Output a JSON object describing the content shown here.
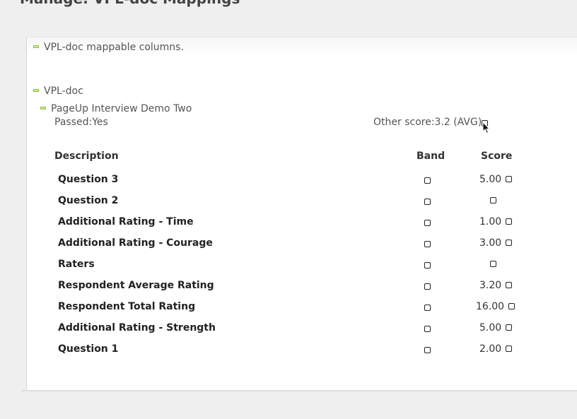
{
  "page": {
    "title": "Manage: VPL-doc Mappings"
  },
  "section": {
    "title": "VPL-doc mappable columns.",
    "group": "VPL-doc",
    "interview": "PageUp Interview Demo Two"
  },
  "summary": {
    "passed_label": "Passed:",
    "passed_value": "Yes",
    "other_score_label": "Other score:",
    "other_score_value": "3.2 (AVG)"
  },
  "table": {
    "columns": [
      "Description",
      "Band",
      "Score"
    ],
    "rows": [
      {
        "label": "Question 3",
        "score": "5.00"
      },
      {
        "label": "Question 2",
        "score": ""
      },
      {
        "label": "Additional Rating - Time",
        "score": "1.00"
      },
      {
        "label": "Additional Rating - Courage",
        "score": "3.00"
      },
      {
        "label": "Raters",
        "score": ""
      },
      {
        "label": "Respondent Average Rating",
        "score": "3.20"
      },
      {
        "label": "Respondent Total Rating",
        "score": "16.00"
      },
      {
        "label": "Additional Rating - Strength",
        "score": "5.00"
      },
      {
        "label": "Question 1",
        "score": "2.00"
      }
    ]
  },
  "colors": {
    "accent": "#8cc63f",
    "panel": "#ffffff",
    "background": "#efefef"
  },
  "icons": {
    "collapse": "minus-icon",
    "pointer": "mouse-cursor-icon"
  }
}
